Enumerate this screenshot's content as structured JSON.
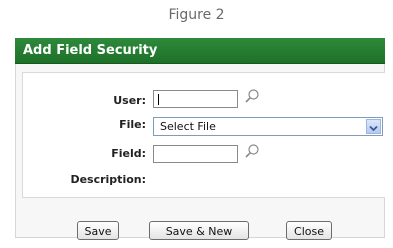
{
  "caption": "Figure 2",
  "dialog": {
    "title": "Add Field Security",
    "title_bar_color": "#2e8a3b"
  },
  "form": {
    "user_label": "User:",
    "user_value": "",
    "file_label": "File:",
    "file_selected": "Select File",
    "field_label": "Field:",
    "field_value": "",
    "description_label": "Description:"
  },
  "icons": {
    "user_lookup": "magnifier-icon",
    "field_lookup": "magnifier-icon",
    "file_dropdown": "chevron-down-icon"
  },
  "buttons": {
    "save": "Save",
    "save_new": "Save & New",
    "close": "Close"
  }
}
